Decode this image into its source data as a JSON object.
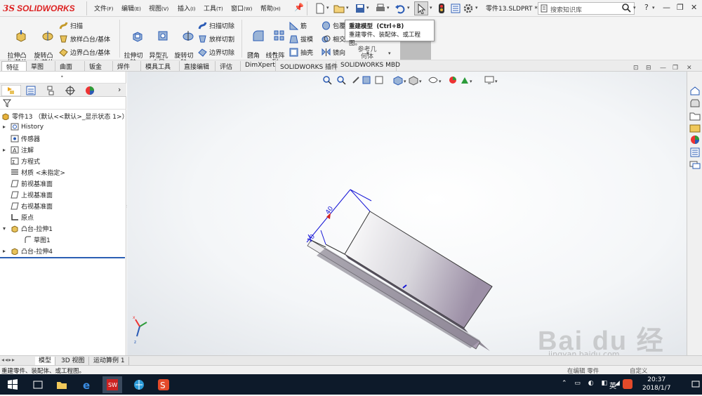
{
  "app": {
    "brand_ds": "3S",
    "brand_name": "SOLIDWORKS"
  },
  "menu": [
    {
      "label": "文件",
      "key": "(F)"
    },
    {
      "label": "编辑",
      "key": "(E)"
    },
    {
      "label": "视图",
      "key": "(V)"
    },
    {
      "label": "插入",
      "key": "(I)"
    },
    {
      "label": "工具",
      "key": "(T)"
    },
    {
      "label": "窗口",
      "key": "(W)"
    },
    {
      "label": "帮助",
      "key": "(H)"
    }
  ],
  "doc_title": "零件13.SLDPRT *",
  "search_placeholder": "搜索知识库",
  "ribbon": {
    "extrude_boss": "拉伸凸\n台/基体",
    "revolve_boss": "旋转凸\n台/基体",
    "sweep": "扫描",
    "loft_boss": "放样凸台/基体",
    "boundary_boss": "边界凸台/基体",
    "extrude_cut": "拉伸切\n除",
    "hole_wizard": "异型孔\n向导",
    "revolve_cut": "旋转切\n除",
    "swept_cut": "扫描切除",
    "lofted_cut": "放样切割",
    "boundary_cut": "边界切除",
    "fillet": "圆角",
    "linear_pattern": "线性阵\n列",
    "rib": "筋",
    "draft": "拔模",
    "shell": "抽壳",
    "wrap": "包覆",
    "intersect": "相交",
    "mirror": "镜向",
    "ref_geometry": "参考几\n何体"
  },
  "tooltip": {
    "title": "重建模型",
    "shortcut": "(Ctrl+B)",
    "desc": "重建零件、装配体、或工程图。"
  },
  "tabs": [
    "特征",
    "草图",
    "曲面",
    "钣金",
    "焊件",
    "模具工具",
    "直接编辑",
    "评估",
    "DimXpert",
    "SOLIDWORKS 插件",
    "SOLIDWORKS MBD"
  ],
  "tree": {
    "root": "零件13 （默认<<默认>_显示状态 1>）",
    "items": [
      {
        "label": "History",
        "icon": "history-icon",
        "arrow": "▸"
      },
      {
        "label": "传感器",
        "icon": "sensor-icon",
        "arrow": ""
      },
      {
        "label": "注解",
        "icon": "annotation-icon",
        "arrow": "▸"
      },
      {
        "label": "方程式",
        "icon": "equation-icon",
        "arrow": ""
      },
      {
        "label": "材质 <未指定>",
        "icon": "material-icon",
        "arrow": ""
      },
      {
        "label": "前视基准面",
        "icon": "plane-icon",
        "arrow": ""
      },
      {
        "label": "上视基准面",
        "icon": "plane-icon",
        "arrow": ""
      },
      {
        "label": "右视基准面",
        "icon": "plane-icon",
        "arrow": ""
      },
      {
        "label": "原点",
        "icon": "origin-icon",
        "arrow": ""
      },
      {
        "label": "凸台-拉伸1",
        "icon": "extrude-icon",
        "arrow": "▾"
      },
      {
        "label": "草图1",
        "icon": "sketch-icon",
        "arrow": ""
      },
      {
        "label": "凸台-拉伸4",
        "icon": "extrude-icon",
        "arrow": "▸"
      }
    ]
  },
  "dimensions": [
    "40",
    "10"
  ],
  "bottom_tabs": [
    "模型",
    "3D 视图",
    "运动算例 1"
  ],
  "status_text": "重建零件、装配体、或工程图。",
  "status_right": [
    "在编辑 零件",
    "自定义"
  ],
  "clock": {
    "time": "20:37",
    "date": "2018/1/7"
  },
  "ime": "英",
  "watermark": {
    "text": "Bai du 经验",
    "sub": "jingyan.baidu.com"
  },
  "colors": {
    "brand": "#d22222",
    "dimension": "#1515d6",
    "part_face": "#e9e9ec",
    "part_dark": "#a79bb0",
    "taskbar": "#0d1a2a"
  }
}
